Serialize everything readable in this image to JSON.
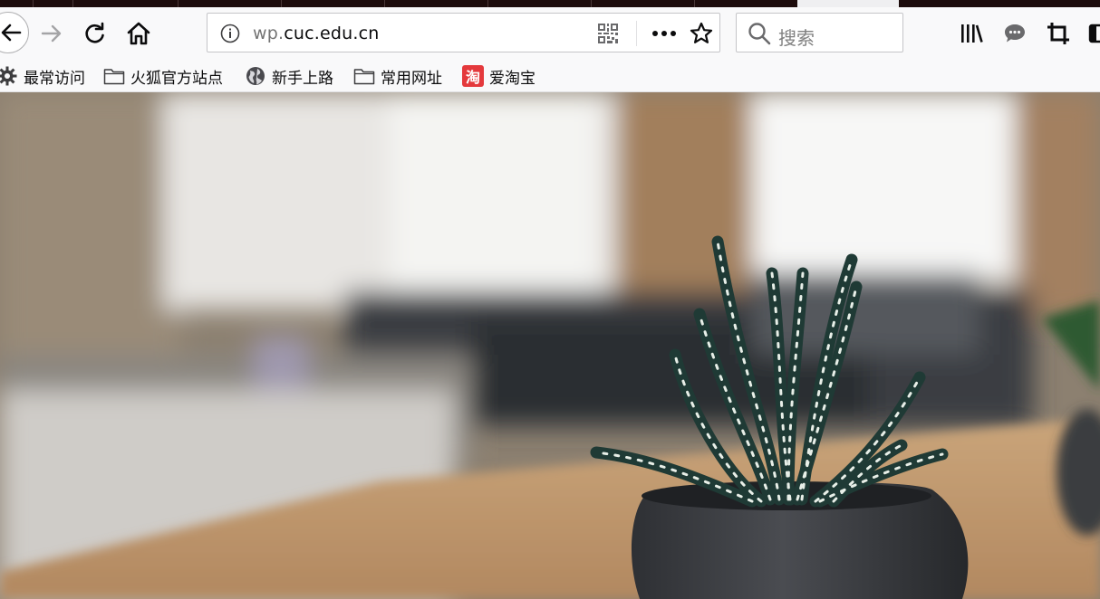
{
  "toolbar": {
    "url_prefix": "wp.",
    "url_host": "cuc.edu.cn",
    "search_placeholder": "搜索"
  },
  "bookmarks": [
    {
      "label": "最常访问",
      "icon": "gear-icon"
    },
    {
      "label": "火狐官方站点",
      "icon": "folder-icon"
    },
    {
      "label": "新手上路",
      "icon": "globe-icon"
    },
    {
      "label": "常用网址",
      "icon": "folder-icon"
    },
    {
      "label": "爱淘宝",
      "icon": "taobao-icon",
      "icon_text": "淘",
      "icon_color": "#e4393c"
    }
  ],
  "colors": {
    "tabstrip": "#1d0c0c",
    "toolbar": "#f9f9fa",
    "icon": "#0c0c0d"
  }
}
